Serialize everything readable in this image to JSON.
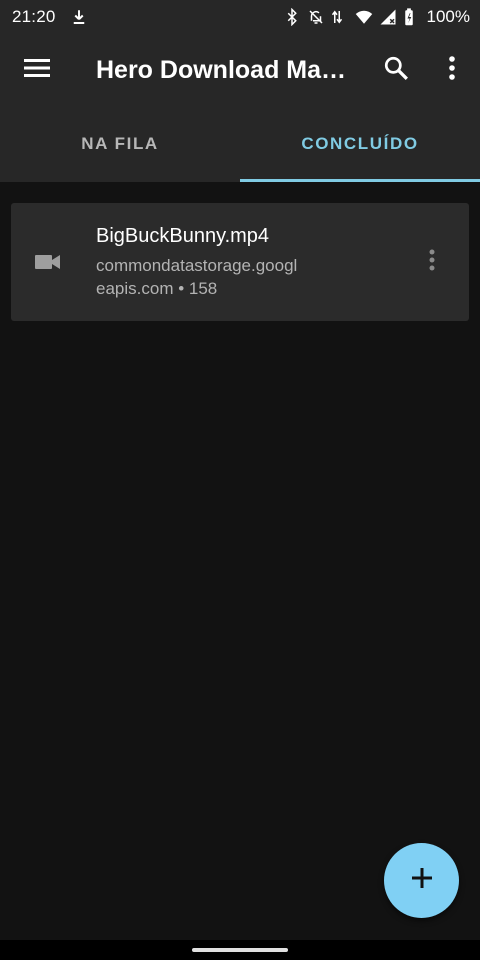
{
  "status_bar": {
    "time": "21:20",
    "battery": "100%",
    "icons": [
      "download-icon",
      "bluetooth-icon",
      "notifications-off-icon",
      "data-arrows-icon",
      "wifi-icon",
      "cellular-icon",
      "battery-icon"
    ]
  },
  "app_bar": {
    "title": "Hero Download Ma…",
    "icons": [
      "menu-icon",
      "search-icon",
      "more-vert-icon"
    ]
  },
  "tabs": [
    {
      "label": "NA FILA",
      "active": false
    },
    {
      "label": "CONCLUÍDO",
      "active": true
    }
  ],
  "downloads": [
    {
      "title": "BigBuckBunny.mp4",
      "subtitle": "commondatastorage.googleapis.com • 158",
      "icon": "videocam-icon"
    }
  ],
  "fab": {
    "icon": "add-icon"
  },
  "colors": {
    "accent": "#80cbe3",
    "fab": "#80d0f4",
    "surface": "#272727",
    "background": "#121212",
    "card": "#2b2b2b"
  }
}
